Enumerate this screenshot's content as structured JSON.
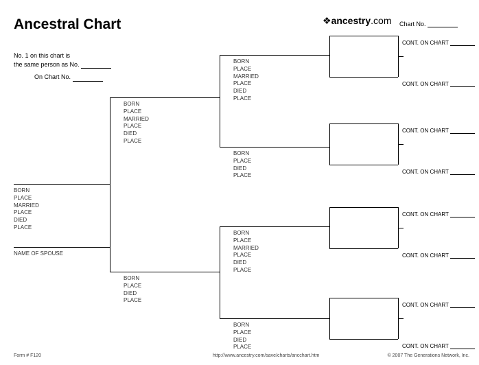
{
  "title": "Ancestral Chart",
  "brand": {
    "name": "ancestry",
    "suffix": ".com",
    "glyph": "❖"
  },
  "chart_no_label": "Chart No.",
  "intro": {
    "line1": "No. 1 on this chart is",
    "line2_a": "the same person as No.",
    "line3_a": "On Chart No."
  },
  "fields6": {
    "f1": "BORN",
    "f2": "PLACE",
    "f3": "MARRIED",
    "f4": "PLACE",
    "f5": "DIED",
    "f6": "PLACE"
  },
  "fields4": {
    "f1": "BORN",
    "f2": "PLACE",
    "f3": "DIED",
    "f4": "PLACE"
  },
  "spouse_label": "NAME OF SPOUSE",
  "cont_label": "CONT. ON CHART",
  "footer": {
    "form": "Form # F120",
    "url": "http://www.ancestry.com/save/charts/ancchart.htm",
    "copy": "© 2007 The Generations Network, Inc."
  }
}
